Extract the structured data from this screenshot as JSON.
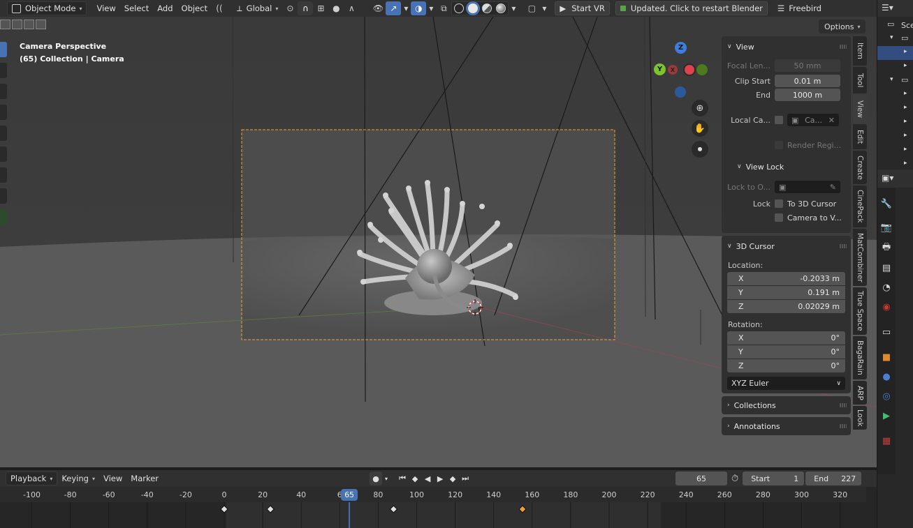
{
  "header": {
    "mode": "Object Mode",
    "menus": [
      "View",
      "Select",
      "Add",
      "Object"
    ],
    "transform_orientation": "Global",
    "start_vr": "Start VR",
    "updated": "Updated. Click to restart Blender",
    "freebird": "Freebird"
  },
  "viewport": {
    "camera_title": "Camera Perspective",
    "camera_subtitle": "(65) Collection | Camera",
    "options": "Options",
    "gizmo": {
      "z": "Z",
      "y": "Y",
      "x": "X"
    },
    "colors": {
      "x": "#e0414e",
      "y": "#7cc42c",
      "z": "#3a7fdc",
      "camera_frame": "#f0a030",
      "cursor": "#e04040"
    }
  },
  "npanel": {
    "view": {
      "title": "View",
      "focal_label": "Focal Len...",
      "focal_value": "50 mm",
      "clip_start_label": "Clip Start",
      "clip_start_value": "0.01 m",
      "clip_end_label": "End",
      "clip_end_value": "1000 m",
      "local_camera_label": "Local Ca...",
      "local_camera_value": "Ca...",
      "render_region": "Render Regi..."
    },
    "view_lock": {
      "title": "View Lock",
      "lock_to_label": "Lock to O...",
      "lock_label": "Lock",
      "to_3d_cursor": "To 3D Cursor",
      "camera_to_view": "Camera to V..."
    },
    "cursor": {
      "title": "3D Cursor",
      "location_label": "Location:",
      "location": [
        {
          "axis": "X",
          "value": "-0.2033 m"
        },
        {
          "axis": "Y",
          "value": "0.191 m"
        },
        {
          "axis": "Z",
          "value": "0.02029 m"
        }
      ],
      "rotation_label": "Rotation:",
      "rotation": [
        {
          "axis": "X",
          "value": "0°"
        },
        {
          "axis": "Y",
          "value": "0°"
        },
        {
          "axis": "Z",
          "value": "0°"
        }
      ],
      "rotation_mode": "XYZ Euler"
    },
    "collections": "Collections",
    "annotations": "Annotations"
  },
  "vtabs": [
    "Item",
    "Tool",
    "View",
    "Edit",
    "Create",
    "CinePack",
    "MatCombiner",
    "True Space",
    "BagaRain",
    "ARP",
    "Look"
  ],
  "outliner": {
    "scene_label": "Sce"
  },
  "timeline": {
    "menus": [
      "Playback",
      "Keying",
      "View",
      "Marker"
    ],
    "current_frame": "65",
    "start_label": "Start",
    "start_value": "1",
    "end_label": "End",
    "end_value": "227",
    "ruler_ticks": [
      "-100",
      "-80",
      "-60",
      "-40",
      "-20",
      "0",
      "20",
      "40",
      "6",
      "80",
      "100",
      "120",
      "140",
      "160",
      "180",
      "200",
      "220",
      "240",
      "260",
      "280",
      "300",
      "320"
    ],
    "playhead_label": "65",
    "keyframes": [
      0,
      24,
      88,
      155
    ],
    "selected_keyframe": 155
  }
}
